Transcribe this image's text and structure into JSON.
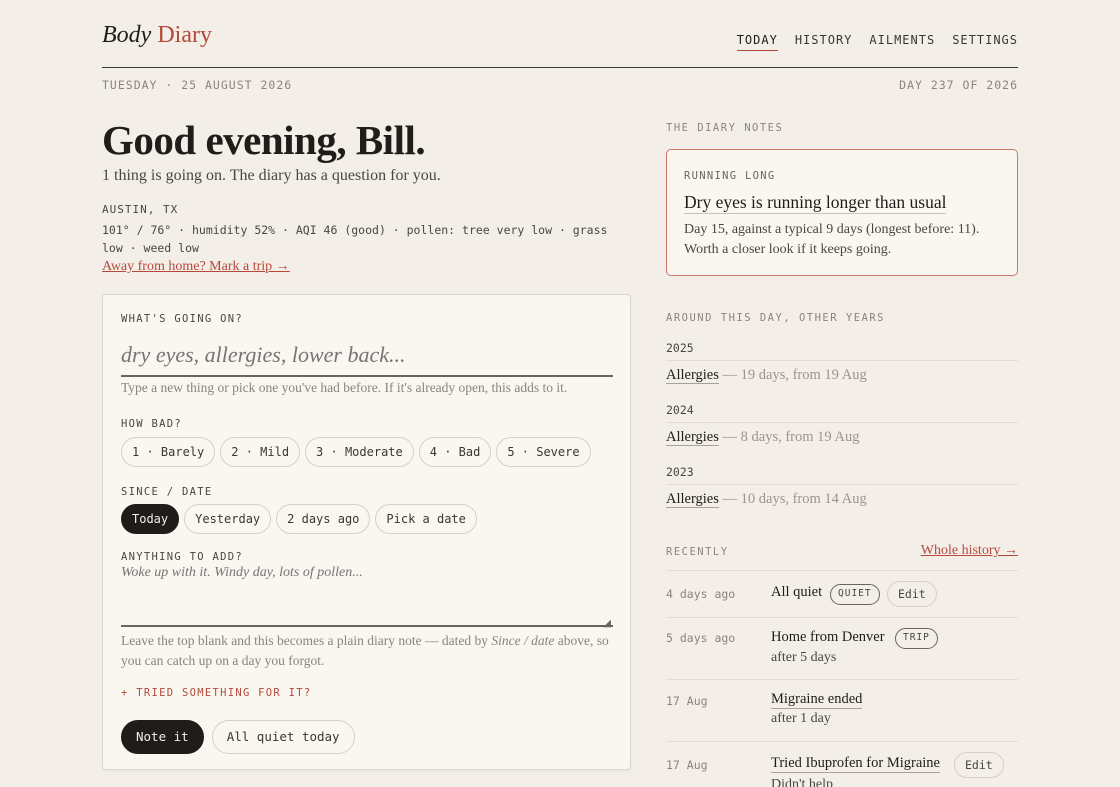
{
  "brand": {
    "part1": "Body",
    "part2": "Diary"
  },
  "nav": {
    "today": "TODAY",
    "history": "HISTORY",
    "ailments": "AILMENTS",
    "settings": "SETTINGS"
  },
  "dateline": {
    "left": "TUESDAY · 25 AUGUST 2026",
    "right": "DAY 237 OF 2026"
  },
  "greeting": "Good evening, Bill.",
  "subline": "1 thing is going on. The diary has a question for you.",
  "location": "AUSTIN, TX",
  "weather": "101° / 76° · humidity 52% · AQI 46 (good) · pollen: tree very low · grass low · weed low",
  "trip_link": "Away from home? Mark a trip →",
  "form": {
    "whats_label": "WHAT'S GOING ON?",
    "whats_placeholder": "dry eyes, allergies, lower back...",
    "whats_hint": "Type a new thing or pick one you've had before. If it's already open, this adds to it.",
    "how_bad_label": "HOW BAD?",
    "severity": [
      "1 · Barely",
      "2 · Mild",
      "3 · Moderate",
      "4 · Bad",
      "5 · Severe"
    ],
    "since_label": "SINCE / DATE",
    "since": [
      "Today",
      "Yesterday",
      "2 days ago",
      "Pick a date"
    ],
    "since_selected": "Today",
    "add_label": "ANYTHING TO ADD?",
    "add_placeholder": "Woke up with it. Windy day, lots of pollen...",
    "explain_pre": "Leave the top blank and this becomes a plain diary note — dated by ",
    "explain_em": "Since / date",
    "explain_post": " above, so you can catch up on a day you forgot.",
    "tried": "+ TRIED SOMETHING FOR IT?",
    "note_btn": "Note it",
    "quiet_btn": "All quiet today"
  },
  "diary_notes": {
    "section_label": "THE DIARY NOTES",
    "tag": "RUNNING LONG",
    "title": "Dry eyes is running longer than usual",
    "body": "Day 15, against a typical 9 days (longest before: 11). Worth a closer look if it keeps going."
  },
  "other_years": {
    "section_label": "AROUND THIS DAY, OTHER YEARS",
    "years": [
      {
        "year": "2025",
        "name": "Allergies",
        "detail": " — 19 days, from 19 Aug"
      },
      {
        "year": "2024",
        "name": "Allergies",
        "detail": " — 8 days, from 19 Aug"
      },
      {
        "year": "2023",
        "name": "Allergies",
        "detail": " — 10 days, from 14 Aug"
      }
    ]
  },
  "recently": {
    "section_label": "RECENTLY",
    "whole_history": "Whole history →",
    "rows": [
      {
        "when": "4 days ago",
        "what": "All quiet",
        "badge": "QUIET",
        "edit": "Edit",
        "sub": ""
      },
      {
        "when": "5 days ago",
        "what": "Home from Denver",
        "badge": "TRIP",
        "edit": "",
        "sub": "after 5 days"
      },
      {
        "when": "17 Aug",
        "what": "Migraine ended",
        "badge": "",
        "edit": "",
        "sub": "after 1 day"
      },
      {
        "when": "17 Aug",
        "what": "Tried Ibuprofen for Migraine",
        "badge": "",
        "edit": "Edit",
        "sub": "Didn't help"
      }
    ]
  },
  "colors": {
    "accent": "#b5483a",
    "background": "#f3efe8",
    "ink": "#1f1d1a"
  }
}
